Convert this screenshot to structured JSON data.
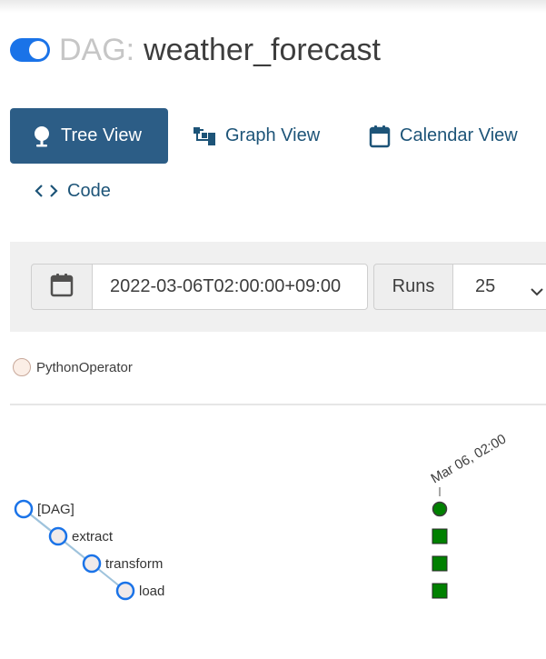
{
  "header": {
    "title_prefix": "DAG:",
    "dag_id": "weather_forecast",
    "toggle_on": true
  },
  "tabs": [
    {
      "label": "Tree View",
      "icon": "tree-icon",
      "active": true
    },
    {
      "label": "Graph View",
      "icon": "graph-icon",
      "active": false
    },
    {
      "label": "Calendar View",
      "icon": "calendar-icon",
      "active": false
    },
    {
      "label": "Code",
      "icon": "code-icon",
      "active": false
    }
  ],
  "filters": {
    "base_date": "2022-03-06T02:00:00+09:00",
    "runs_label": "Runs",
    "runs_value": "25"
  },
  "legend": {
    "operator": "PythonOperator"
  },
  "tree": {
    "run_label": "Mar 06, 02:00",
    "nodes": [
      {
        "label": "[DAG]",
        "state": "success"
      },
      {
        "label": "extract",
        "state": "success"
      },
      {
        "label": "transform",
        "state": "success"
      },
      {
        "label": "load",
        "state": "success"
      }
    ]
  },
  "colors": {
    "active_tab": "#2c5d86",
    "toggle": "#1a73e8",
    "link": "#1d5478",
    "success": "#008000",
    "node_ring": "#1a73e8",
    "node_fill": "#f0eaea",
    "operator_fill": "#fbeee6"
  }
}
